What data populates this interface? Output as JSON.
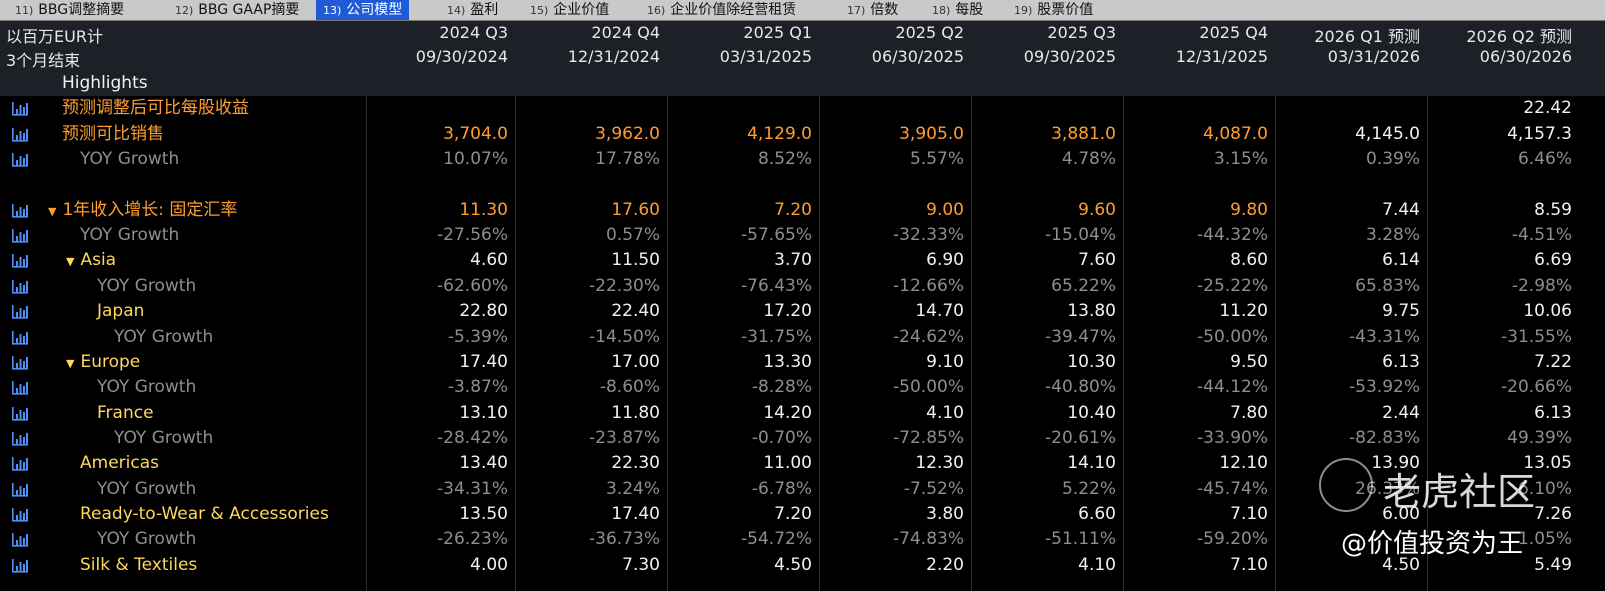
{
  "tabs": [
    {
      "num": "11)",
      "label": "BBG调整摘要"
    },
    {
      "num": "12)",
      "label": "BBG GAAP摘要"
    },
    {
      "num": "13)",
      "label": "公司模型"
    },
    {
      "num": "14)",
      "label": "盈利"
    },
    {
      "num": "15)",
      "label": "企业价值"
    },
    {
      "num": "16)",
      "label": "企业价值除经营租赁"
    },
    {
      "num": "17)",
      "label": "倍数"
    },
    {
      "num": "18)",
      "label": "每股"
    },
    {
      "num": "19)",
      "label": "股票价值"
    }
  ],
  "header": {
    "currency_label": "以百万EUR计",
    "period_label": "3个月结束",
    "columns": [
      {
        "quarter": "2024 Q3",
        "date": "09/30/2024"
      },
      {
        "quarter": "2024 Q4",
        "date": "12/31/2024"
      },
      {
        "quarter": "2025 Q1",
        "date": "03/31/2025"
      },
      {
        "quarter": "2025 Q2",
        "date": "06/30/2025"
      },
      {
        "quarter": "2025 Q3",
        "date": "09/30/2025"
      },
      {
        "quarter": "2025 Q4",
        "date": "12/31/2025"
      },
      {
        "quarter": "2026 Q1 预测",
        "date": "03/31/2026"
      },
      {
        "quarter": "2026 Q2 预测",
        "date": "06/30/2026"
      }
    ]
  },
  "rows": [
    {
      "label": "Highlights",
      "style": "section",
      "indent": 0,
      "values": [
        "",
        "",
        "",
        "",
        "",
        "",
        "",
        ""
      ]
    },
    {
      "label": "预测调整后可比每股收益",
      "style": "orange",
      "indent": 0,
      "chart": true,
      "values": [
        "",
        "",
        "",
        "",
        "",
        "",
        "",
        "22.42"
      ]
    },
    {
      "label": "预测可比销售",
      "style": "orange",
      "indent": 0,
      "chart": true,
      "values": [
        "3,704.0",
        "3,962.0",
        "4,129.0",
        "3,905.0",
        "3,881.0",
        "4,087.0",
        "4,145.0",
        "4,157.3"
      ]
    },
    {
      "label": "YOY Growth",
      "style": "gray",
      "indent": 1,
      "chart": true,
      "values": [
        "10.07%",
        "17.78%",
        "8.52%",
        "5.57%",
        "4.78%",
        "3.15%",
        "0.39%",
        "6.46%"
      ]
    },
    {
      "label": "",
      "style": "blank",
      "indent": 0,
      "values": [
        "",
        "",
        "",
        "",
        "",
        "",
        "",
        ""
      ]
    },
    {
      "label": "1年收入增长: 固定汇率",
      "style": "orange",
      "indent": 0,
      "chart": true,
      "caret": true,
      "values": [
        "11.30",
        "17.60",
        "7.20",
        "9.00",
        "9.60",
        "9.80",
        "7.44",
        "8.59"
      ]
    },
    {
      "label": "YOY Growth",
      "style": "gray",
      "indent": 1,
      "chart": true,
      "values": [
        "-27.56%",
        "0.57%",
        "-57.65%",
        "-32.33%",
        "-15.04%",
        "-44.32%",
        "3.28%",
        "-4.51%"
      ]
    },
    {
      "label": "Asia",
      "style": "yellow",
      "indent": 1,
      "chart": true,
      "caret": true,
      "values": [
        "4.60",
        "11.50",
        "3.70",
        "6.90",
        "7.60",
        "8.60",
        "6.14",
        "6.69"
      ]
    },
    {
      "label": "YOY Growth",
      "style": "gray",
      "indent": 2,
      "chart": true,
      "values": [
        "-62.60%",
        "-22.30%",
        "-76.43%",
        "-12.66%",
        "65.22%",
        "-25.22%",
        "65.83%",
        "-2.98%"
      ]
    },
    {
      "label": "Japan",
      "style": "yellow",
      "indent": 2,
      "chart": true,
      "values": [
        "22.80",
        "22.40",
        "17.20",
        "14.70",
        "13.80",
        "11.20",
        "9.75",
        "10.06"
      ]
    },
    {
      "label": "YOY Growth",
      "style": "gray",
      "indent": 3,
      "chart": true,
      "values": [
        "-5.39%",
        "-14.50%",
        "-31.75%",
        "-24.62%",
        "-39.47%",
        "-50.00%",
        "-43.31%",
        "-31.55%"
      ]
    },
    {
      "label": "Europe",
      "style": "yellow",
      "indent": 1,
      "chart": true,
      "caret": true,
      "values": [
        "17.40",
        "17.00",
        "13.30",
        "9.10",
        "10.30",
        "9.50",
        "6.13",
        "7.22"
      ]
    },
    {
      "label": "YOY Growth",
      "style": "gray",
      "indent": 2,
      "chart": true,
      "values": [
        "-3.87%",
        "-8.60%",
        "-8.28%",
        "-50.00%",
        "-40.80%",
        "-44.12%",
        "-53.92%",
        "-20.66%"
      ]
    },
    {
      "label": "France",
      "style": "yellow",
      "indent": 2,
      "chart": true,
      "values": [
        "13.10",
        "11.80",
        "14.20",
        "4.10",
        "10.40",
        "7.80",
        "2.44",
        "6.13"
      ]
    },
    {
      "label": "YOY Growth",
      "style": "gray",
      "indent": 3,
      "chart": true,
      "values": [
        "-28.42%",
        "-23.87%",
        "-0.70%",
        "-72.85%",
        "-20.61%",
        "-33.90%",
        "-82.83%",
        "49.39%"
      ]
    },
    {
      "label": "Americas",
      "style": "yellow",
      "indent": 1,
      "chart": true,
      "values": [
        "13.40",
        "22.30",
        "11.00",
        "12.30",
        "14.10",
        "12.10",
        "13.90",
        "13.05"
      ]
    },
    {
      "label": "YOY Growth",
      "style": "gray",
      "indent": 2,
      "chart": true,
      "values": [
        "-34.31%",
        "3.24%",
        "-6.78%",
        "-7.52%",
        "5.22%",
        "-45.74%",
        "26.33%",
        "6.10%"
      ]
    },
    {
      "label": "Ready-to-Wear & Accessories",
      "style": "yellow",
      "indent": 1,
      "chart": true,
      "values": [
        "13.50",
        "17.40",
        "7.20",
        "3.80",
        "6.60",
        "7.10",
        "6.00",
        "7.26"
      ]
    },
    {
      "label": "YOY Growth",
      "style": "gray",
      "indent": 2,
      "chart": true,
      "values": [
        "-26.23%",
        "-36.73%",
        "-54.72%",
        "-74.83%",
        "-51.11%",
        "-59.20%",
        "",
        "1.05%"
      ]
    },
    {
      "label": "Silk & Textiles",
      "style": "yellow",
      "indent": 1,
      "chart": true,
      "values": [
        "4.00",
        "7.30",
        "4.50",
        "2.20",
        "4.10",
        "7.10",
        "4.50",
        "5.49"
      ]
    }
  ],
  "watermark": {
    "brand": "老虎社区",
    "handle": "@价值投资为王"
  },
  "colors": {
    "orange": "#ff9d2e",
    "yellow": "#ffd75a",
    "gray": "#8e8e8e",
    "active_tab": "#1f5bd6",
    "header_bg": "#1d2027"
  },
  "icons": {
    "row_chart": "bar-chart-icon",
    "expand": "triangle-down-icon"
  }
}
